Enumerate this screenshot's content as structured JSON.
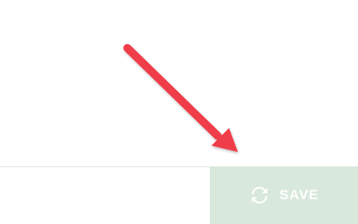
{
  "footer": {
    "save_label": "SAVE"
  },
  "icons": {
    "save_icon": "sync-icon",
    "annotation": "arrow-pointer-icon"
  },
  "colors": {
    "save_button_bg": "#d9e8dc",
    "save_button_text": "#ffffff",
    "annotation_arrow": "#ef3d48",
    "divider": "#e2e2e2"
  }
}
